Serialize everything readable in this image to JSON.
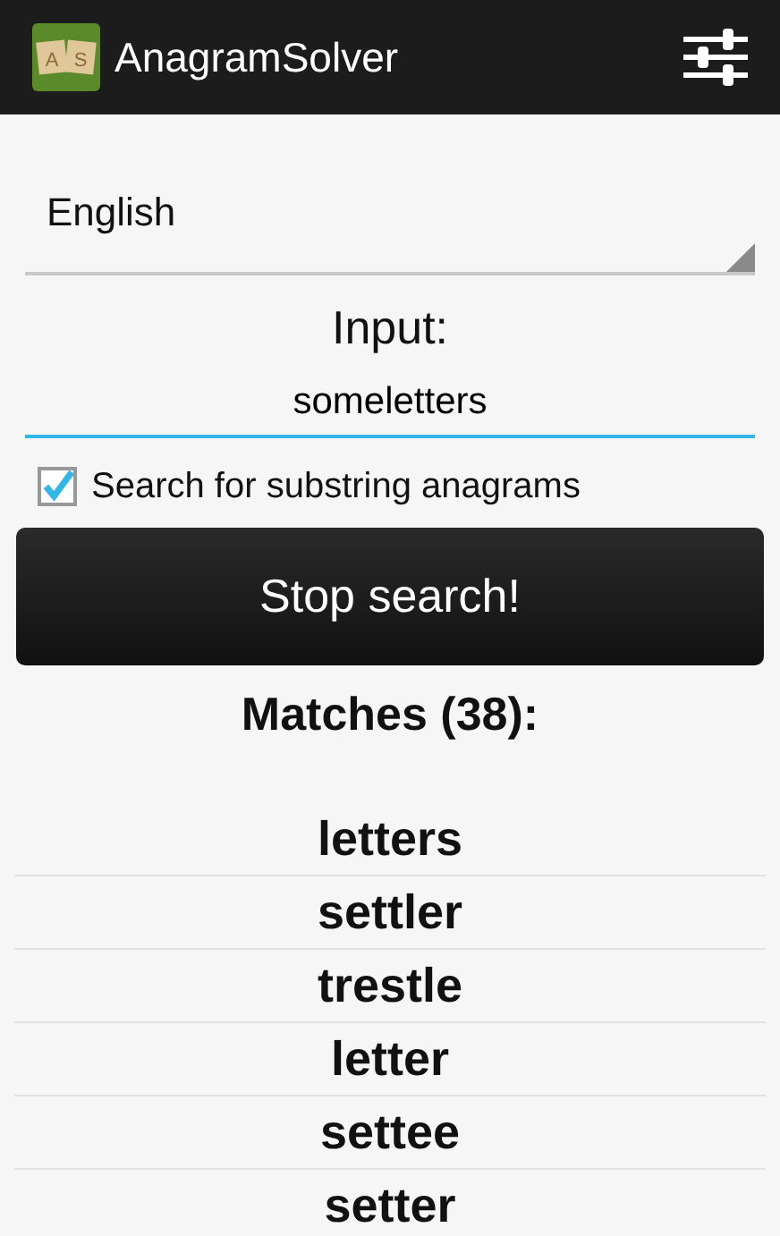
{
  "app_bar": {
    "title": "AnagramSolver",
    "logo_letters": [
      "A",
      "S"
    ]
  },
  "language": {
    "value": "English"
  },
  "input": {
    "label": "Input:",
    "value": "someletters",
    "focused": true
  },
  "substring_option": {
    "label": "Search for substring anagrams",
    "checked": true
  },
  "action_button": {
    "label": "Stop search!"
  },
  "matches": {
    "heading": "Matches (38):",
    "items": [
      "letters",
      "settler",
      "trestle",
      "letter",
      "settee",
      "setter"
    ]
  }
}
